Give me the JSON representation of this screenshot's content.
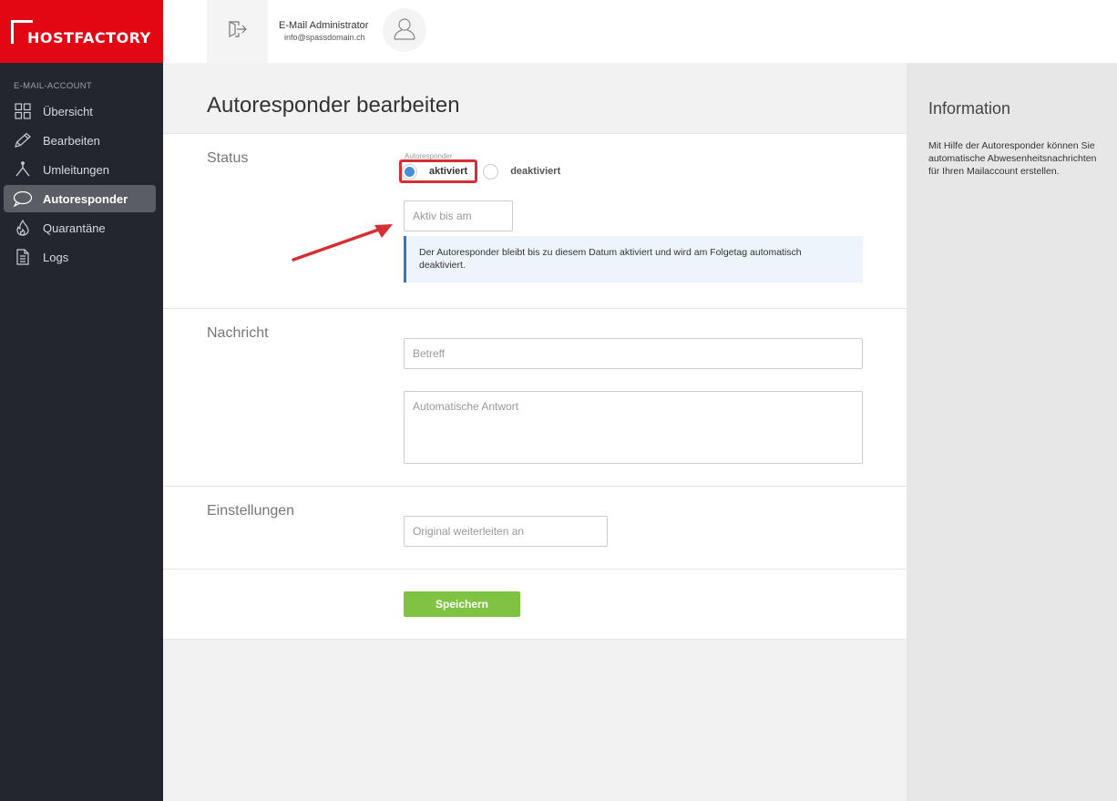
{
  "brand": {
    "name": "HOSTFACTORY",
    "color": "#e30613"
  },
  "sidebar": {
    "section": "E-MAIL-ACCOUNT",
    "items": [
      {
        "label": "Übersicht",
        "icon": "grid-icon"
      },
      {
        "label": "Bearbeiten",
        "icon": "pencil-icon"
      },
      {
        "label": "Umleitungen",
        "icon": "fork-icon"
      },
      {
        "label": "Autoresponder",
        "icon": "speech-bubble-icon",
        "active": true
      },
      {
        "label": "Quarantäne",
        "icon": "flame-icon"
      },
      {
        "label": "Logs",
        "icon": "document-icon"
      }
    ]
  },
  "header": {
    "user_name": "E-Mail Administrator",
    "user_email": "info@spassdomain.ch"
  },
  "main": {
    "title": "Autoresponder bearbeiten",
    "status": {
      "label": "Status",
      "radio_caption": "Autoresponder",
      "option_on": "aktiviert",
      "option_off": "deaktiviert",
      "selected": "aktiviert",
      "date_placeholder": "Aktiv bis am",
      "hint": "Der Autoresponder bleibt bis zu diesem Datum aktiviert und wird am Folgetag automatisch deaktiviert."
    },
    "message": {
      "label": "Nachricht",
      "subject_placeholder": "Betreff",
      "answer_placeholder": "Automatische Antwort"
    },
    "settings": {
      "label": "Einstellungen",
      "forward_placeholder": "Original weiterleiten an"
    },
    "save_label": "Speichern"
  },
  "info": {
    "title": "Information",
    "text": "Mit Hilfe der Autoresponder können Sie automatische Abwesenheitsnachrichten für Ihren Mailaccount erstellen."
  },
  "colors": {
    "accent_green": "#80c342",
    "highlight_red": "#d62f33",
    "info_blue": "#2d79c7"
  }
}
